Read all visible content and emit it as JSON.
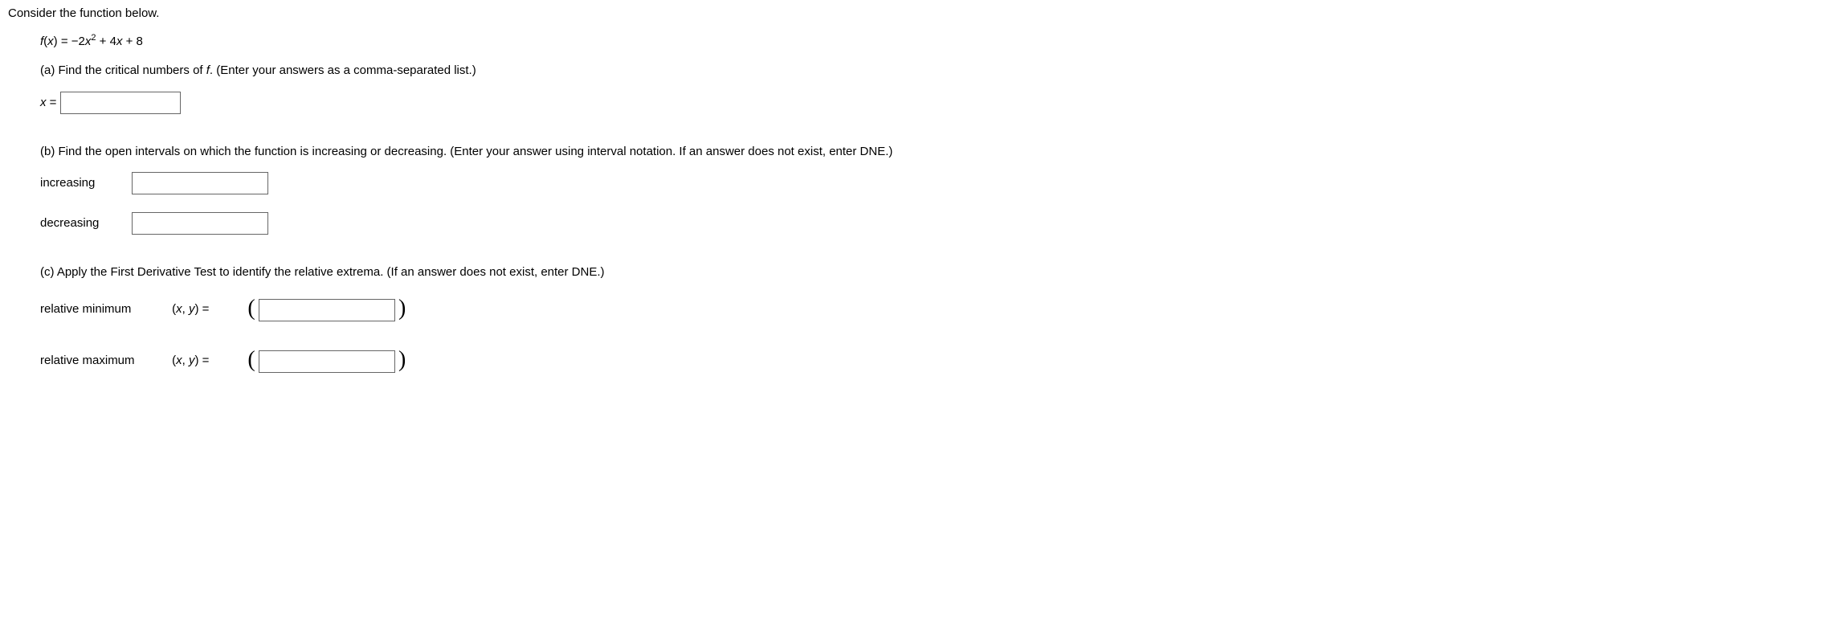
{
  "intro": "Consider the function below.",
  "func": {
    "lhs": "f",
    "lpar": "(",
    "var": "x",
    "rpar": ")",
    "eq": " = ",
    "neg2": "−2",
    "var2": "x",
    "exp": "2",
    "plus4x": " + 4",
    "var3": "x",
    "plus8": " + 8"
  },
  "partA": {
    "text_before": "(a) Find the critical numbers of ",
    "fvar": "f",
    "text_after": ". (Enter your answers as a comma-separated list.)",
    "xlabel_var": "x",
    "xlabel_eq": " = "
  },
  "partB": {
    "text": "(b) Find the open intervals on which the function is increasing or decreasing. (Enter your answer using interval notation. If an answer does not exist, enter DNE.)",
    "inc_label": "increasing",
    "dec_label": "decreasing"
  },
  "partC": {
    "text": "(c) Apply the First Derivative Test to identify the relative extrema. (If an answer does not exist, enter DNE.)",
    "relmin_label": "relative minimum",
    "relmax_label": "relative maximum",
    "xy_open": "(",
    "xy_x": "x",
    "xy_comma": ", ",
    "xy_y": "y",
    "xy_close": ")",
    "xy_eq": "  =  ",
    "big_open": "(",
    "big_close": ")"
  }
}
